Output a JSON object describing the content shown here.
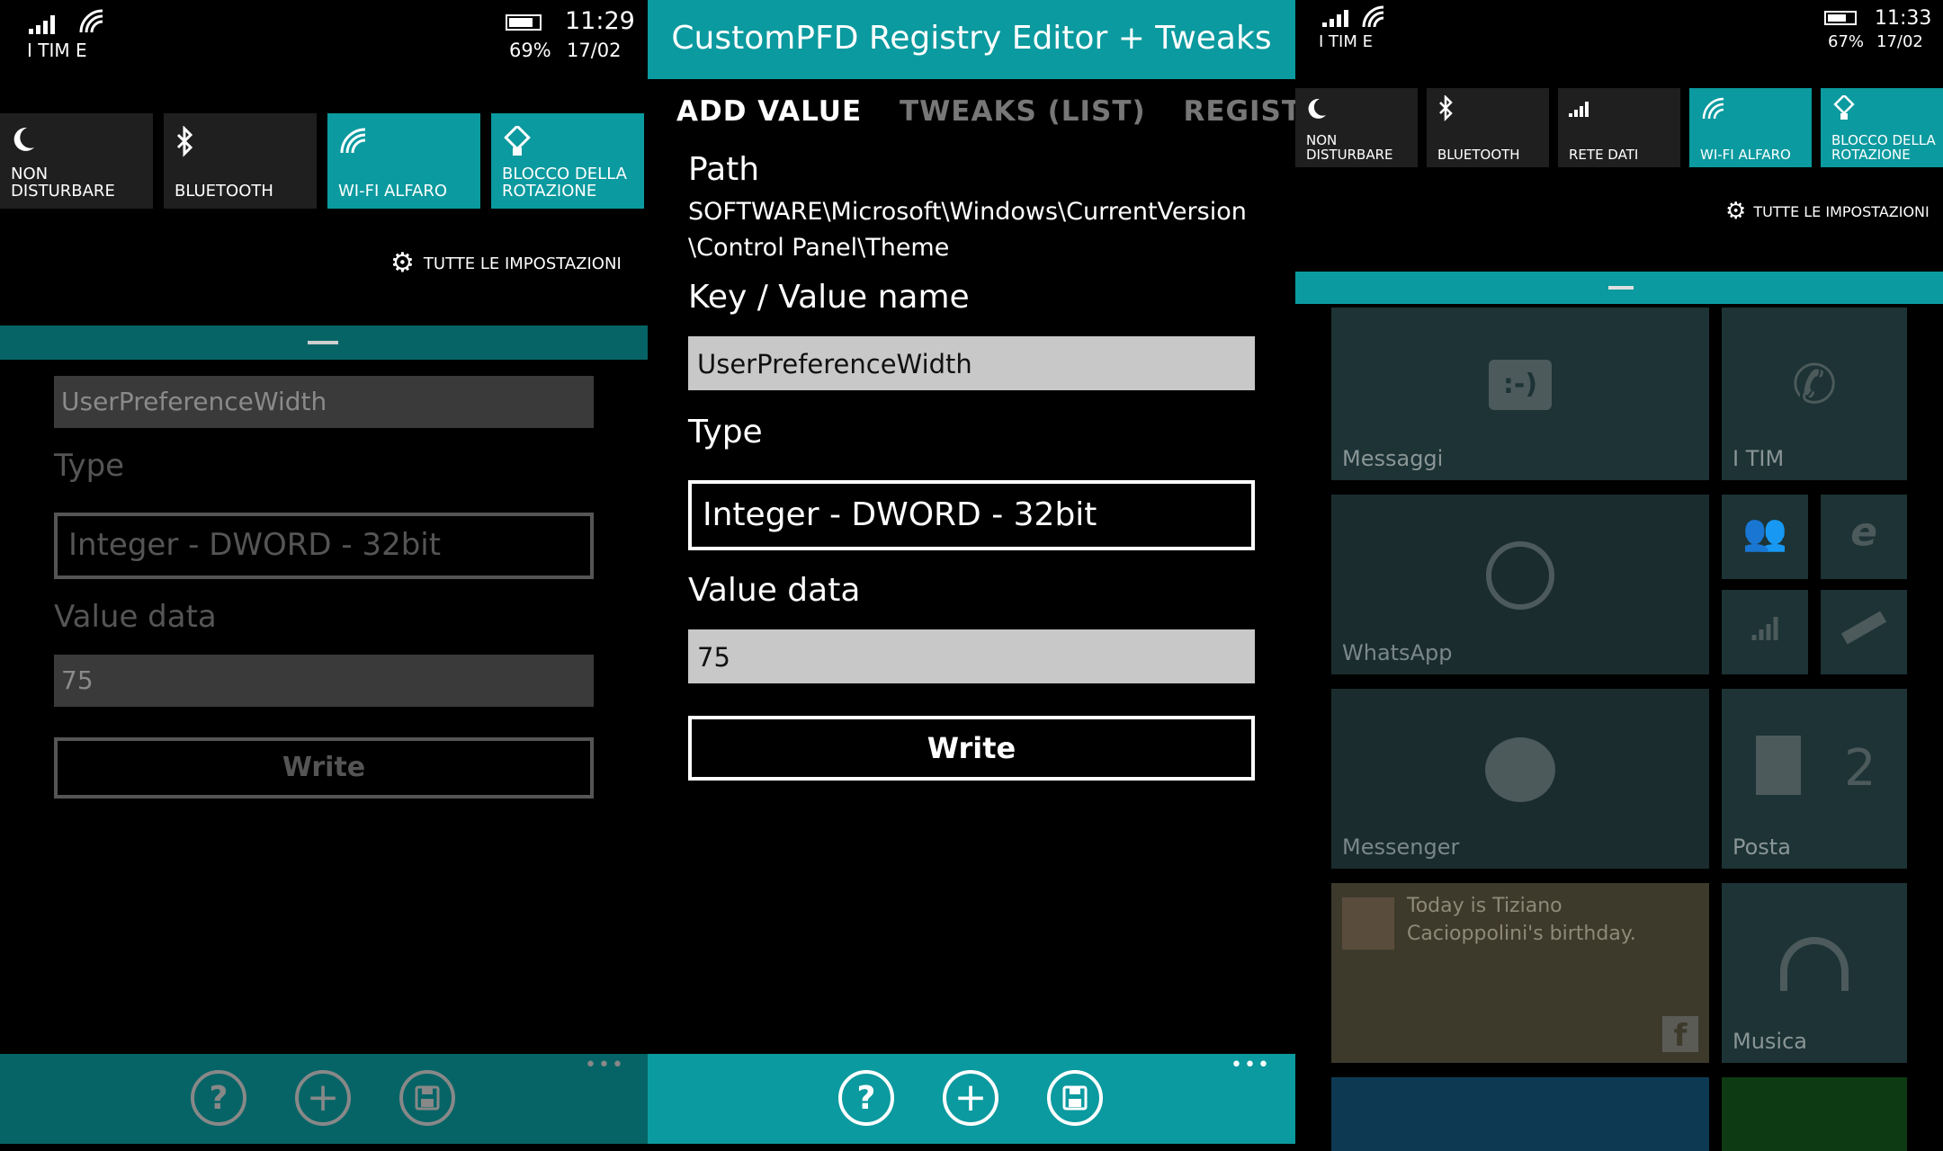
{
  "left": {
    "status": {
      "carrier": "I TIM E",
      "battery": "69%",
      "time": "11:29",
      "date": "17/02"
    },
    "quick_actions": [
      "NON DISTURBARE",
      "BLUETOOTH",
      "WI-FI ALFARO",
      "BLOCCO DELLA ROTAZIONE"
    ],
    "all_settings": "TUTTE LE IMPOSTAZIONI",
    "key_value": "UserPreferenceWidth",
    "type_label": "Type",
    "type_value": "Integer - DWORD - 32bit",
    "value_label": "Value data",
    "value": "75",
    "write": "Write"
  },
  "middle": {
    "title": "CustomPFD Registry Editor + Tweaks",
    "tabs": [
      "ADD VALUE",
      "TWEAKS (LIST)",
      "REGISTRY TREE"
    ],
    "path_label": "Path",
    "path_line1": "SOFTWARE\\Microsoft\\Windows\\CurrentVersion",
    "path_line2": "\\Control Panel\\Theme",
    "key_label": "Key / Value name",
    "key_value": "UserPreferenceWidth",
    "type_label": "Type",
    "type_value": "Integer - DWORD - 32bit",
    "value_label": "Value data",
    "value": "75",
    "write": "Write",
    "appbar_more": "•••"
  },
  "right": {
    "status": {
      "carrier": "I TIM E",
      "battery": "67%",
      "time": "11:33",
      "date": "17/02"
    },
    "quick_actions": [
      "NON DISTURBARE",
      "BLUETOOTH",
      "RETE DATI",
      "WI-FI ALFARO",
      "BLOCCO DELLA ROTAZIONE"
    ],
    "all_settings": "TUTTE LE IMPOSTAZIONI",
    "tiles": {
      "messaggi": "Messaggi",
      "phone": "I TIM",
      "whatsapp": "WhatsApp",
      "messenger": "Messenger",
      "posta": "Posta",
      "posta_count": "2",
      "birthday": "Today is Tiziano Cacioppolini's birthday.",
      "musica": "Musica"
    }
  },
  "colors": {
    "accent": "#0b9a9f",
    "accent_dim": "#066466",
    "field_light": "#c8c8c8",
    "field_dark": "#3a3a3a"
  }
}
